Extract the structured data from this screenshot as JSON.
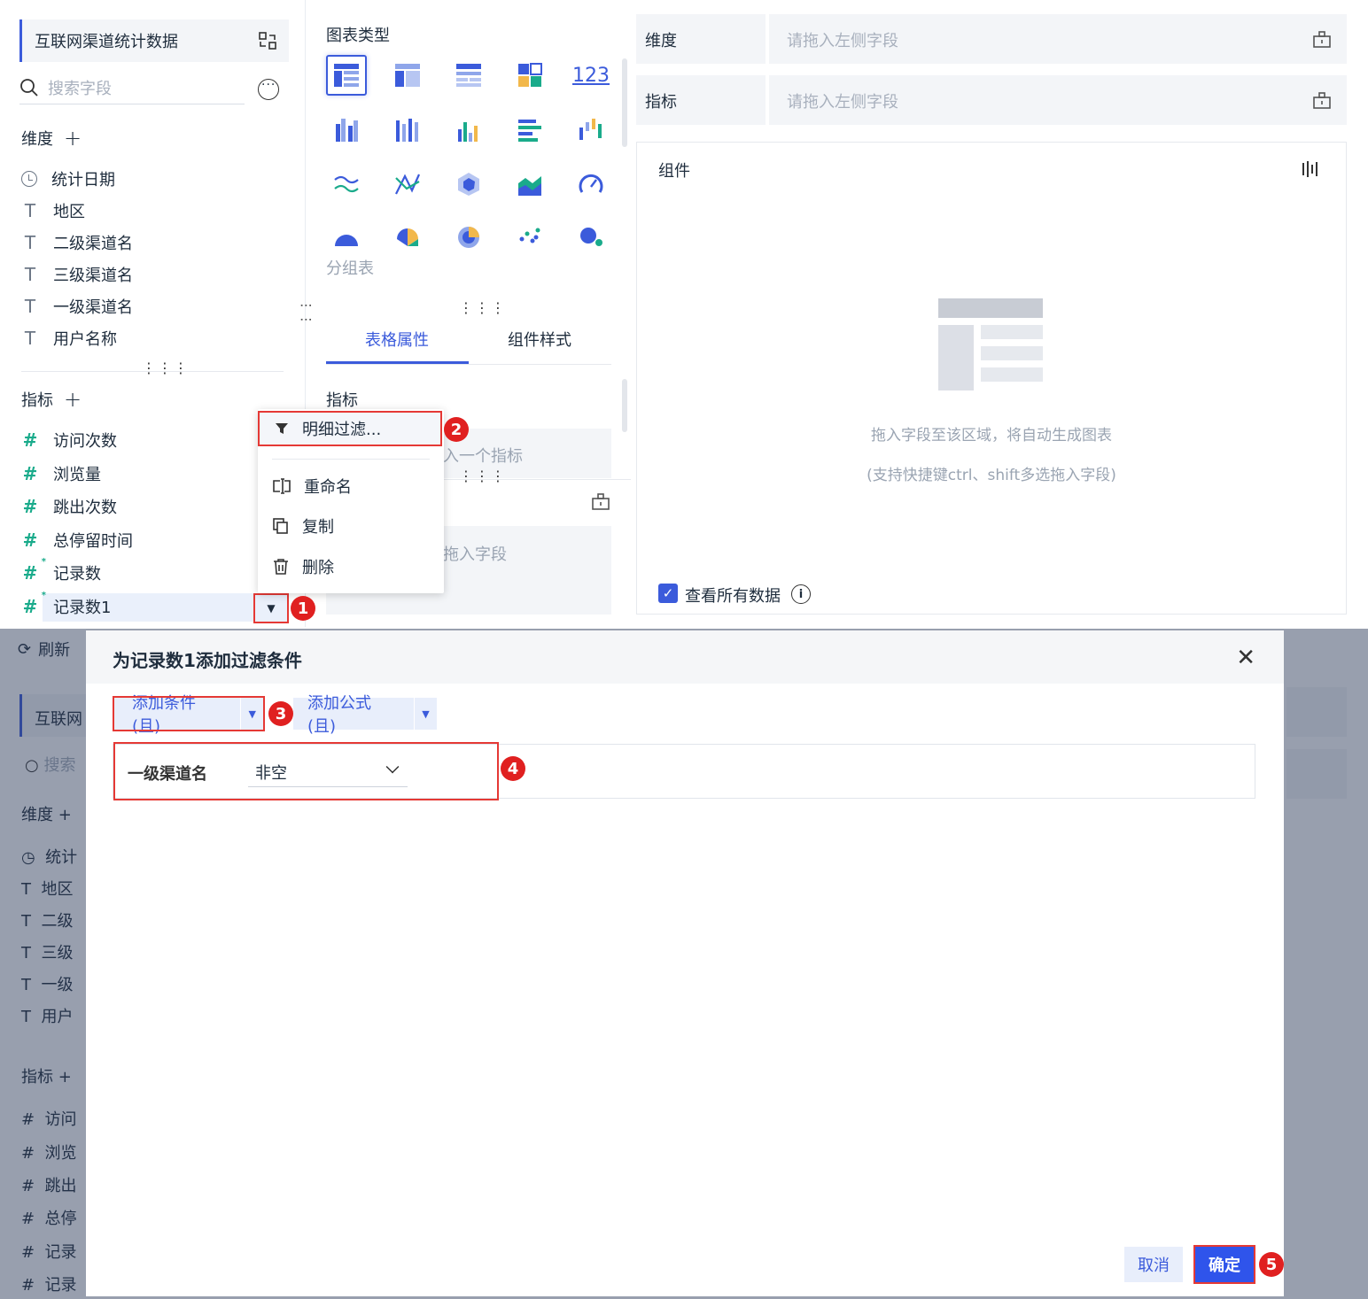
{
  "dataset": {
    "name": "互联网渠道统计数据"
  },
  "search": {
    "placeholder": "搜索字段"
  },
  "dimensions": {
    "title": "维度",
    "fields": [
      "统计日期",
      "地区",
      "二级渠道名",
      "三级渠道名",
      "一级渠道名",
      "用户名称"
    ]
  },
  "measures": {
    "title": "指标",
    "fields": [
      "访问次数",
      "浏览量",
      "跳出次数",
      "总停留时间",
      "记录数",
      "记录数1"
    ]
  },
  "context_menu": {
    "items": [
      "明细过滤...",
      "重命名",
      "复制",
      "删除"
    ]
  },
  "chart_panel": {
    "title": "图表类型",
    "hover_label": "分组表",
    "tabs": [
      "表格属性",
      "组件样式"
    ],
    "section_measure": "指标",
    "drop_measure_hint": "入一个指标",
    "drop_field_hint": "拖入字段"
  },
  "config": {
    "dimension_label": "维度",
    "measure_label": "指标",
    "drop_placeholder": "请拖入左侧字段",
    "component_title": "组件",
    "empty_hint": "拖入字段至该区域，将自动生成图表",
    "empty_subhint": "(支持快捷键ctrl、shift多选拖入字段)",
    "view_all": "查看所有数据",
    "number_icon": "123"
  },
  "background": {
    "refresh": "刷新",
    "dataset_partial": "互联网",
    "search_partial": "搜索",
    "dim_title": "维度",
    "dim_partials": [
      "统计",
      "地区",
      "二级",
      "三级",
      "一级",
      "用户"
    ],
    "measure_title": "指标",
    "measure_partials": [
      "访问",
      "浏览",
      "跳出",
      "总停",
      "记录",
      "记录"
    ]
  },
  "dialog": {
    "title": "为记录数1添加过滤条件",
    "add_condition": "添加条件(且)",
    "add_formula": "添加公式(且)",
    "condition_field": "一级渠道名",
    "condition_operator": "非空",
    "cancel": "取消",
    "confirm": "确定"
  },
  "annotations": [
    "1",
    "2",
    "3",
    "4",
    "5"
  ],
  "colors": {
    "accent": "#3b5bdb",
    "highlight": "#e53935",
    "measure_icon": "#1aab8b"
  }
}
